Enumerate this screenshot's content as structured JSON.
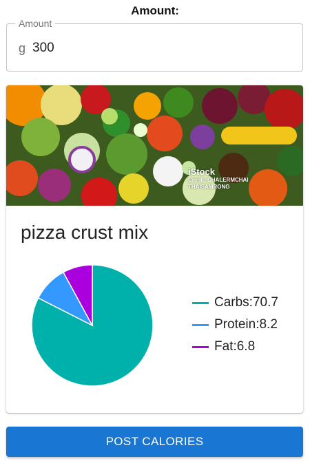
{
  "header": {
    "title": "Amount:"
  },
  "amount_field": {
    "label": "Amount",
    "unit": "g",
    "value": "300"
  },
  "card": {
    "image": {
      "description_icon": "vegetables-photo",
      "watermark_brand": "iStock",
      "watermark_credit": "Credit: CHALERMCHAI THAISAMRONG"
    },
    "food_name": "pizza crust mix"
  },
  "chart_data": {
    "type": "pie",
    "title": "",
    "series": [
      {
        "name": "Carbs",
        "value": 70.7,
        "color": "#00b0aa"
      },
      {
        "name": "Protein",
        "value": 8.2,
        "color": "#3399ff"
      },
      {
        "name": "Fat",
        "value": 6.8,
        "color": "#aa00dd"
      }
    ],
    "legend_labels": [
      "Carbs:70.7",
      "Protein:8.2",
      "Fat:6.8"
    ],
    "legend_placement": "right"
  },
  "actions": {
    "post_label": "POST CALORIES",
    "accent": "#1976d2"
  }
}
